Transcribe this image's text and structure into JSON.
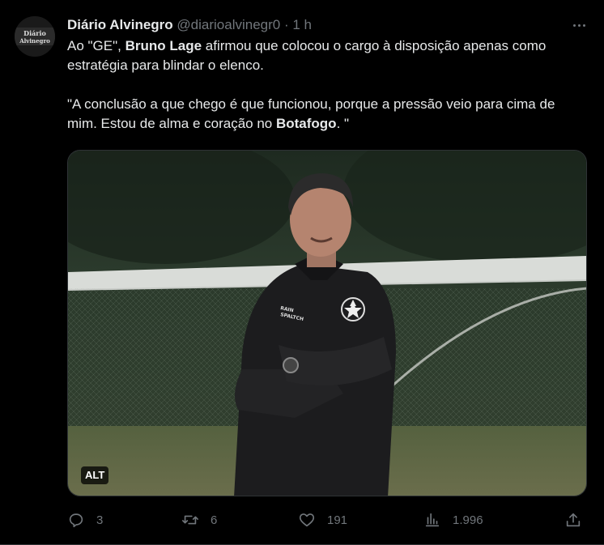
{
  "author": {
    "name": "Diário Alvinegro",
    "handle": "@diarioalvinegr0",
    "time": "1 h",
    "avatar_text": [
      "Diário",
      "Alvinegro"
    ]
  },
  "text": {
    "p1": {
      "pre": "Ao \"GE\", ",
      "bold": "Bruno Lage",
      "post": " afirmou que colocou o cargo à disposição apenas como estratégia para blindar o elenco."
    },
    "p2": {
      "pre": "\"A conclusão a que chego é que funcionou, porque a pressão veio para cima de mim. Estou de alma e coração no ",
      "bold": "Botafogo",
      "post": ". \""
    }
  },
  "media": {
    "alt_badge": "ALT",
    "jacket_brand": "RAIN\nSPALTCH"
  },
  "actions": {
    "replies": "3",
    "retweets": "6",
    "likes": "191",
    "views": "1.996"
  },
  "colors": {
    "background": "#000000",
    "text": "#e7e9ea",
    "muted": "#71767b"
  }
}
